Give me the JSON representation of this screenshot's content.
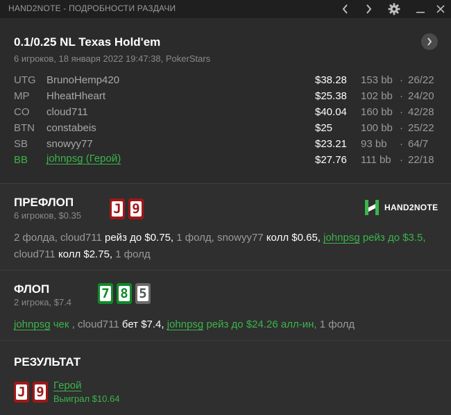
{
  "window": {
    "title": "HAND2NOTE - ПОДРОБНОСТИ РАЗДАЧИ"
  },
  "hand": {
    "game": "0.1/0.25 NL Texas Hold'em",
    "info": "6 игроков, 18 января 2022 19:47:38, PokerStars",
    "players": [
      {
        "pos": "UTG",
        "name": "BrunoHemp420",
        "stack": "$38.28",
        "bb": "153 bb",
        "dot": "·",
        "stat": "26/22"
      },
      {
        "pos": "MP",
        "name": "HheatHheart",
        "stack": "$25.38",
        "bb": "102 bb",
        "dot": "·",
        "stat": "24/20"
      },
      {
        "pos": "CO",
        "name": "cloud711",
        "stack": "$40.04",
        "bb": "160 bb",
        "dot": "·",
        "stat": "42/28"
      },
      {
        "pos": "BTN",
        "name": "constabeis",
        "stack": "$25",
        "bb": "100 bb",
        "dot": "·",
        "stat": "25/22"
      },
      {
        "pos": "SB",
        "name": "snowyy77",
        "stack": "$23.21",
        "bb": "93 bb",
        "dot": "·",
        "stat": "64/7"
      },
      {
        "pos": "BB",
        "name": "johnpsg (Герой)",
        "stack": "$27.76",
        "bb": "111 bb",
        "dot": "·",
        "stat": "22/18"
      }
    ]
  },
  "preflop": {
    "title": "ПРЕФЛОП",
    "sub": "6 игроков, $0.35",
    "cards": [
      "J",
      "9"
    ],
    "actions": {
      "a1": "2 фолда, ",
      "a2": "cloud711 ",
      "a3": "рейз до $0.75,",
      "a4": " 1 фолд, snowyy77 ",
      "a5": "колл $0.65,",
      "a6": "johnpsg",
      "a7": " рейз до $3.5,",
      "a8": " cloud711 ",
      "a9": "колл $2.75,",
      "a10": " 1 фолд"
    }
  },
  "flop": {
    "title": "ФЛОП",
    "sub": "2 игрока, $7.4",
    "cards": [
      "7",
      "8",
      "5"
    ],
    "actions": {
      "a1": "johnpsg",
      "a2": " чек ",
      "a3": ", cloud711 ",
      "a4": "бет $7.4,",
      "a5": "johnpsg",
      "a6": " рейз до $24.26 алл-ин,",
      "a7": " 1 фолд"
    }
  },
  "result": {
    "title": "РЕЗУЛЬТАТ",
    "cards": [
      "J",
      "9"
    ],
    "hero": "Герой",
    "won": "Выиграл $10.64"
  },
  "logo": {
    "text": "HAND2NOTE"
  },
  "colors": {
    "hero_green": "#3ab54a",
    "card_red": "#a01818",
    "card_green": "#0f8a2a",
    "card_gray": "#6a6a6a"
  },
  "icons": {
    "back": "chevron-left-icon",
    "forward": "chevron-right-icon",
    "settings": "gear-icon",
    "minimize": "minimize-icon",
    "close": "close-icon",
    "next_hand": "chevron-right-icon"
  }
}
